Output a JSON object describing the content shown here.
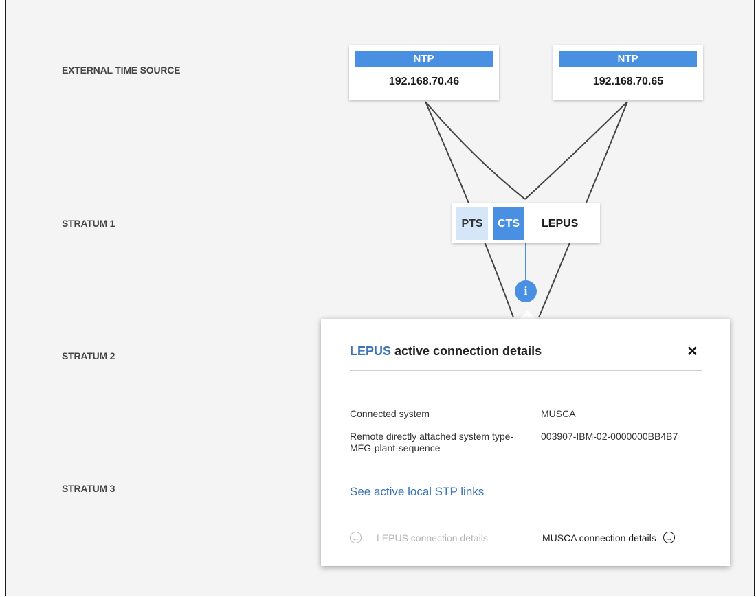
{
  "rows": {
    "external": "EXTERNAL TIME SOURCE",
    "stratum1": "STRATUM 1",
    "stratum2": "STRATUM 2",
    "stratum3": "STRATUM 3"
  },
  "ntp_sources": [
    {
      "label": "NTP",
      "ip": "192.168.70.46"
    },
    {
      "label": "NTP",
      "ip": "192.168.70.65"
    }
  ],
  "stratum1_system": {
    "pts_label": "PTS",
    "cts_label": "CTS",
    "name": "LEPUS"
  },
  "info_icon": {
    "glyph": "i",
    "icon": "info-icon"
  },
  "popup": {
    "title_highlight": "LEPUS",
    "title_rest": " active connection details",
    "close_glyph": "✕",
    "details": [
      {
        "key": "Connected system",
        "value": "MUSCA"
      },
      {
        "key": "Remote directly attached system type-MFG-plant-sequence",
        "value": "003907-IBM-02-0000000BB4B7"
      }
    ],
    "stp_link": "See active local STP links",
    "prev_nav": {
      "label": "LEPUS connection details",
      "icon": "arrow-left-circle-icon",
      "glyph": "←"
    },
    "next_nav": {
      "label": "MUSCA connection details",
      "icon": "arrow-right-circle-icon",
      "glyph": "→"
    }
  },
  "colors": {
    "accent": "#4a90e2",
    "accent_light": "#d5e6f8",
    "link": "#3b73b9",
    "background": "#f4f4f4"
  }
}
